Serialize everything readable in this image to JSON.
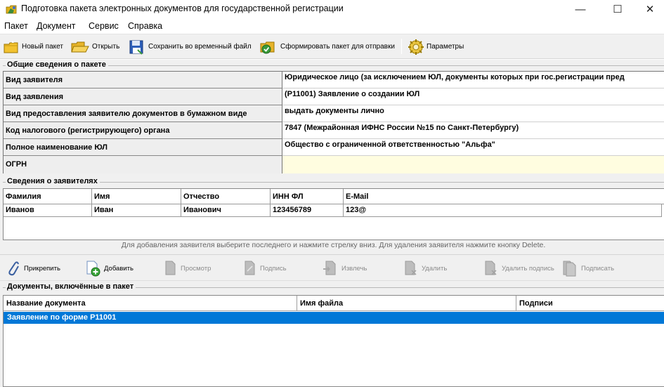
{
  "window": {
    "title": "Подготовка пакета электронных документов для государственной регистрации",
    "minimize": "—",
    "maximize": "☐",
    "close": "✕"
  },
  "menu": [
    "Пакет",
    "Документ",
    "Сервис",
    "Справка"
  ],
  "toolbar": {
    "new_package": "Новый пакет",
    "open": "Открыть",
    "save_temp": "Сохранить во временный файл",
    "build_package": "Сформировать пакет для отправки",
    "settings": "Параметры"
  },
  "general": {
    "section_title": "Общие сведения о пакете",
    "rows": [
      {
        "key": "Вид заявителя",
        "value": "Юридическое лицо (за исключением ЮЛ, документы которых при гос.регистрации пред"
      },
      {
        "key": "Вид заявления",
        "value": "(Р11001) Заявление о создании ЮЛ"
      },
      {
        "key": "Вид предоставления заявителю документов в бумажном виде",
        "value": "выдать документы лично"
      },
      {
        "key": "Код налогового (регистрирующего) органа",
        "value": "7847 (Межрайонная ИФНС России №15 по Санкт-Петербургу)"
      },
      {
        "key": "Полное наименование ЮЛ",
        "value": "Общество с ограниченной ответственностью \"Альфа\""
      },
      {
        "key": "ОГРН",
        "value": ""
      }
    ]
  },
  "applicants": {
    "section_title": "Сведения о заявителях",
    "columns": [
      "Фамилия",
      "Имя",
      "Отчество",
      "ИНН ФЛ",
      "E-Mail"
    ],
    "rows": [
      [
        "Иванов",
        "Иван",
        "Иванович",
        "123456789",
        "123@"
      ]
    ],
    "hint": "Для добавления заявителя выберите последнего и нажмите стрелку вниз. Для удаления заявителя нажмите кнопку Delete."
  },
  "doc_toolbar": {
    "attach": "Прикрепить",
    "add": "Добавить",
    "view": "Просмотр",
    "sign": "Подпись",
    "extract": "Извлечь",
    "delete": "Удалить",
    "delete_sign": "Удалить подпись",
    "sign_all": "Подписать"
  },
  "documents": {
    "section_title": "Документы, включённые в пакет",
    "columns": [
      "Название документа",
      "Имя файла",
      "Подписи"
    ],
    "rows": [
      {
        "name": "Заявление по форме Р11001",
        "file": "",
        "signs": ""
      }
    ]
  },
  "colors": {
    "selection": "#0078d7",
    "ogrn_bg": "#fffde0",
    "toolbar_bg": "#f0f0f0"
  }
}
